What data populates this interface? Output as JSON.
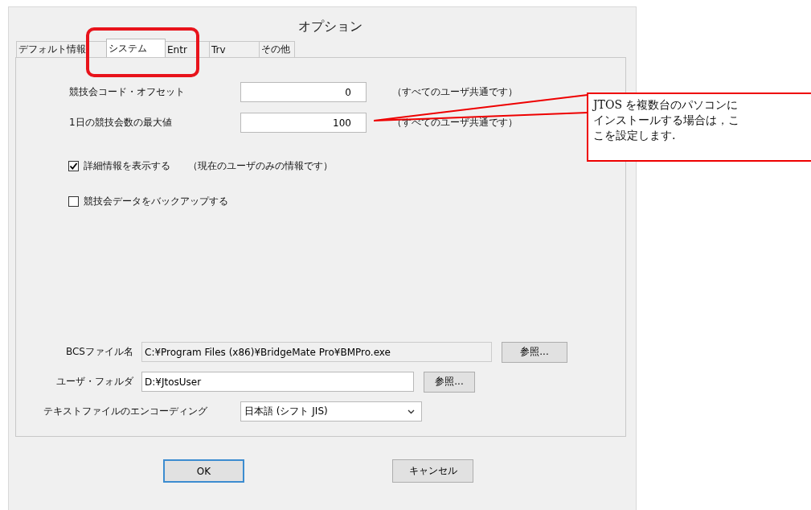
{
  "window": {
    "title": "オプション"
  },
  "tabs": [
    {
      "label": "デフォルト情報",
      "selected": false
    },
    {
      "label": "システム",
      "selected": true
    },
    {
      "label": "Entr",
      "selected": false
    },
    {
      "label": "Trv",
      "selected": false
    },
    {
      "label": "その他",
      "selected": false
    }
  ],
  "number_fields": [
    {
      "label": "競技会コード・オフセット",
      "value": "0",
      "note": "（すべてのユーザ共通です）"
    },
    {
      "label": "1日の競技会数の最大値",
      "value": "100",
      "note": "（すべてのユーザ共通です）"
    }
  ],
  "checkboxes": [
    {
      "label": "詳細情報を表示する",
      "checked": true,
      "note": "（現在のユーザのみの情報です）"
    },
    {
      "label": "競技会データをバックアップする",
      "checked": false
    }
  ],
  "path_fields": [
    {
      "label": "BCSファイル名",
      "value": "C:¥Program Files (x86)¥BridgeMate Pro¥BMPro.exe",
      "button": "参照...",
      "editable": false
    },
    {
      "label": "ユーザ・フォルダ",
      "value": "D:¥JtosUser",
      "button": "参照...",
      "editable": true
    }
  ],
  "encoding": {
    "label": "テキストファイルのエンコーディング",
    "value": "日本語 (シフト JIS)"
  },
  "buttons": [
    {
      "label": "OK",
      "default": true
    },
    {
      "label": "キャンセル",
      "default": false
    }
  ],
  "callout": {
    "lines": [
      "JTOS を複数台のパソコンに",
      "インストールする場合は，こ",
      "こを設定します."
    ]
  }
}
